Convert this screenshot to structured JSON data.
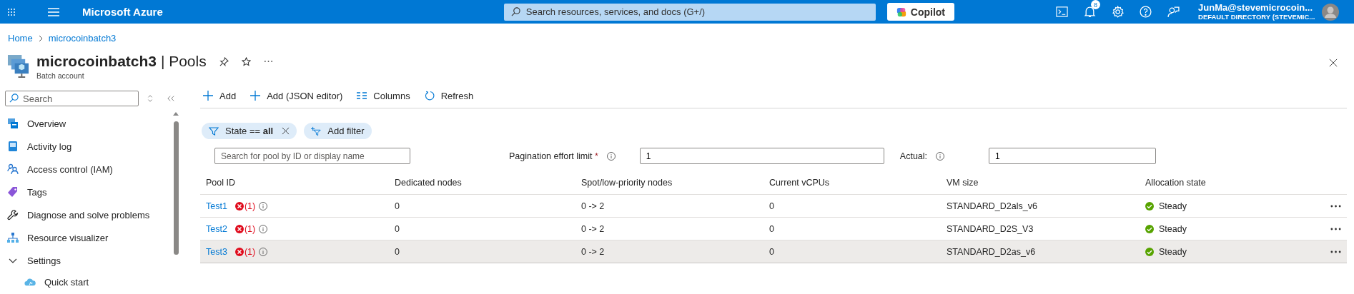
{
  "topbar": {
    "brand": "Microsoft Azure",
    "search": {
      "placeholder": "Search resources, services, and docs (G+/)"
    },
    "copilot": "Copilot",
    "notifications": "8",
    "user": {
      "name": "JunMa@stevemicrocoin...",
      "directory": "DEFAULT DIRECTORY (STEVEMIC..."
    }
  },
  "breadcrumb": [
    "Home",
    "microcoinbatch3"
  ],
  "header": {
    "title": "**microcoinbatch3** | Pools",
    "subtitle": "Batch account"
  },
  "sidebar": {
    "search": {
      "placeholder": "Search"
    },
    "items": [
      {
        "label": "Overview"
      },
      {
        "label": "Activity log"
      },
      {
        "label": "Access control (IAM)"
      },
      {
        "label": "Tags"
      },
      {
        "label": "Diagnose and solve problems"
      },
      {
        "label": "Resource visualizer"
      },
      {
        "label": "Settings",
        "expanded": true,
        "children": [
          {
            "label": "Quick start"
          }
        ]
      }
    ]
  },
  "toolbar": [
    "Add",
    "Add (JSON editor)",
    "Columns",
    "Refresh"
  ],
  "filters": [
    {
      "kind": "applied",
      "label": "State == **all**"
    },
    {
      "kind": "add",
      "label": "Add filter"
    }
  ],
  "pool_search": {
    "placeholder": "Search for pool by ID or display name"
  },
  "pagination": {
    "label": "Pagination effort limit",
    "required_mark": "*",
    "value": "1",
    "actual_label": "Actual:",
    "actual_value": "1"
  },
  "table": {
    "columns": [
      "Pool ID",
      "Dedicated nodes",
      "Spot/low-priority nodes",
      "Current vCPUs",
      "VM size",
      "Allocation state"
    ],
    "rows": [
      {
        "pool_id": "Test1",
        "errors": "(1)",
        "dedicated": "0",
        "spot": "0 -> 2",
        "vcpus": "0",
        "vm_size": "STANDARD_D2als_v6",
        "state": "Steady",
        "selected": false
      },
      {
        "pool_id": "Test2",
        "errors": "(1)",
        "dedicated": "0",
        "spot": "0 -> 2",
        "vcpus": "0",
        "vm_size": "STANDARD_D2S_V3",
        "state": "Steady",
        "selected": false
      },
      {
        "pool_id": "Test3",
        "errors": "(1)",
        "dedicated": "0",
        "spot": "0 -> 2",
        "vcpus": "0",
        "vm_size": "STANDARD_D2as_v6",
        "state": "Steady",
        "selected": true
      }
    ]
  }
}
